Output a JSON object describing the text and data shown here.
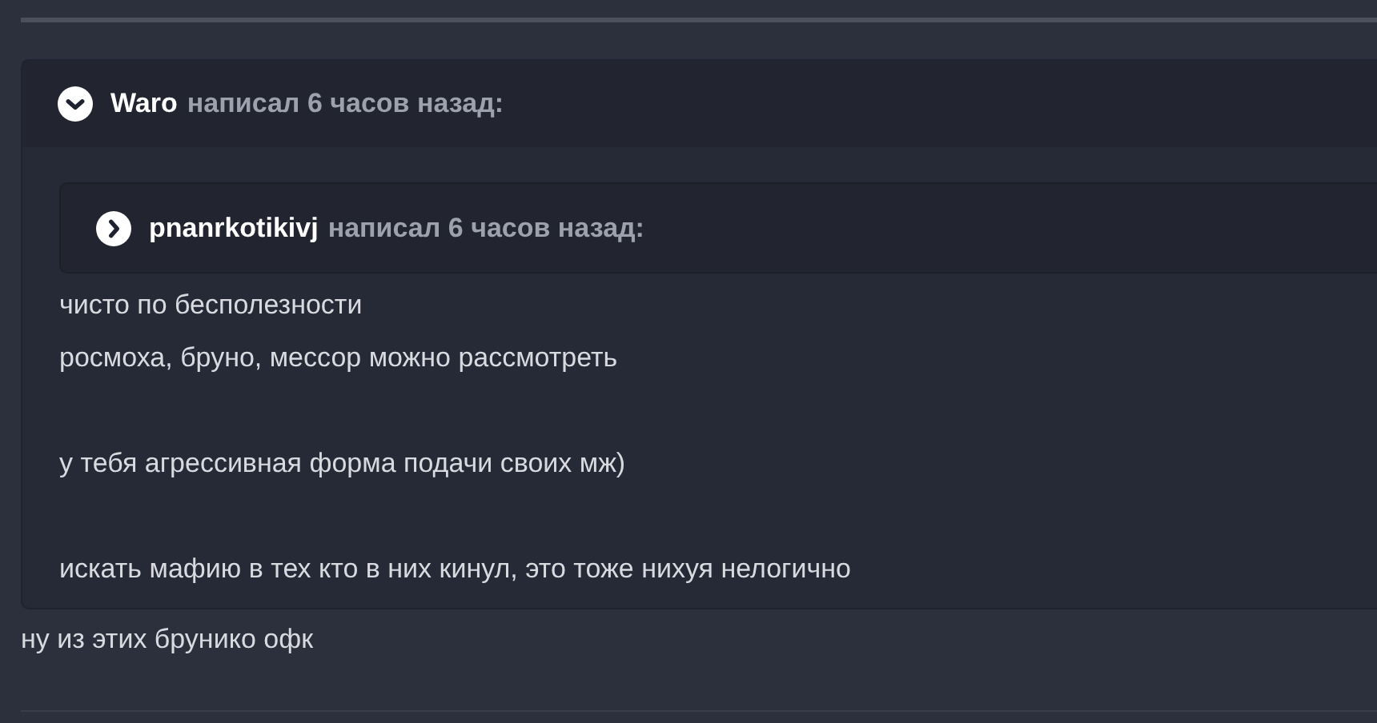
{
  "quote": {
    "author": "Waro",
    "meta": "написал 6 часов назад:",
    "expanded": true,
    "nested_quote": {
      "author": "pnanrkotikivj",
      "meta": "написал 6 часов назад:",
      "expanded": false
    },
    "paragraphs": [
      [
        "чисто по бесполезности",
        "росмоха, бруно, мессор можно рассмотреть"
      ],
      [
        "у тебя агрессивная форма подачи своих мж)"
      ],
      [
        "искать мафию в тех кто в них кинул, это тоже нихуя нелогично"
      ]
    ]
  },
  "reply": "ну из этих брунико офк"
}
